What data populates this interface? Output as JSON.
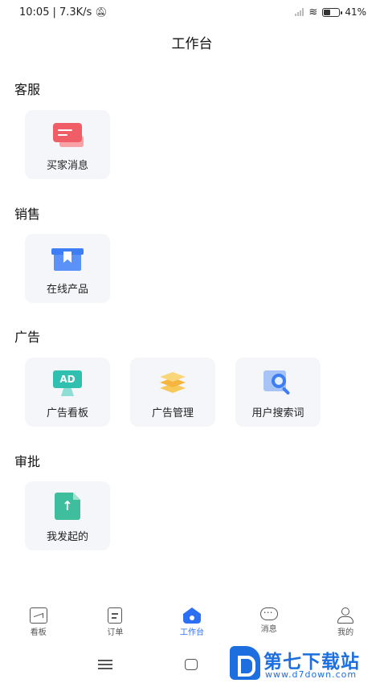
{
  "status": {
    "time": "10:05",
    "speed": "| 7.3K/s",
    "mute_icon": "bell-off-icon",
    "battery": "41%",
    "battery_level": 41
  },
  "header": {
    "title": "工作台"
  },
  "sections": [
    {
      "title": "客服",
      "items": [
        {
          "label": "买家消息",
          "icon": "chat-icon"
        }
      ]
    },
    {
      "title": "销售",
      "items": [
        {
          "label": "在线产品",
          "icon": "box-icon"
        }
      ]
    },
    {
      "title": "广告",
      "items": [
        {
          "label": "广告看板",
          "icon": "ad-board-icon"
        },
        {
          "label": "广告管理",
          "icon": "layers-icon"
        },
        {
          "label": "用户搜索词",
          "icon": "search-icon"
        }
      ]
    },
    {
      "title": "审批",
      "items": [
        {
          "label": "我发起的",
          "icon": "upload-doc-icon"
        }
      ]
    }
  ],
  "tabs": [
    {
      "label": "看板",
      "icon": "chart-board-icon"
    },
    {
      "label": "订单",
      "icon": "order-icon"
    },
    {
      "label": "工作台",
      "icon": "home-icon",
      "active": true
    },
    {
      "label": "消息",
      "icon": "message-icon"
    },
    {
      "label": "我的",
      "icon": "user-icon"
    }
  ],
  "watermark": {
    "title": "第七下载站",
    "url": "www.d7down.com"
  },
  "colors": {
    "accent": "#2d6ff3",
    "card_bg": "#f5f6f9"
  }
}
